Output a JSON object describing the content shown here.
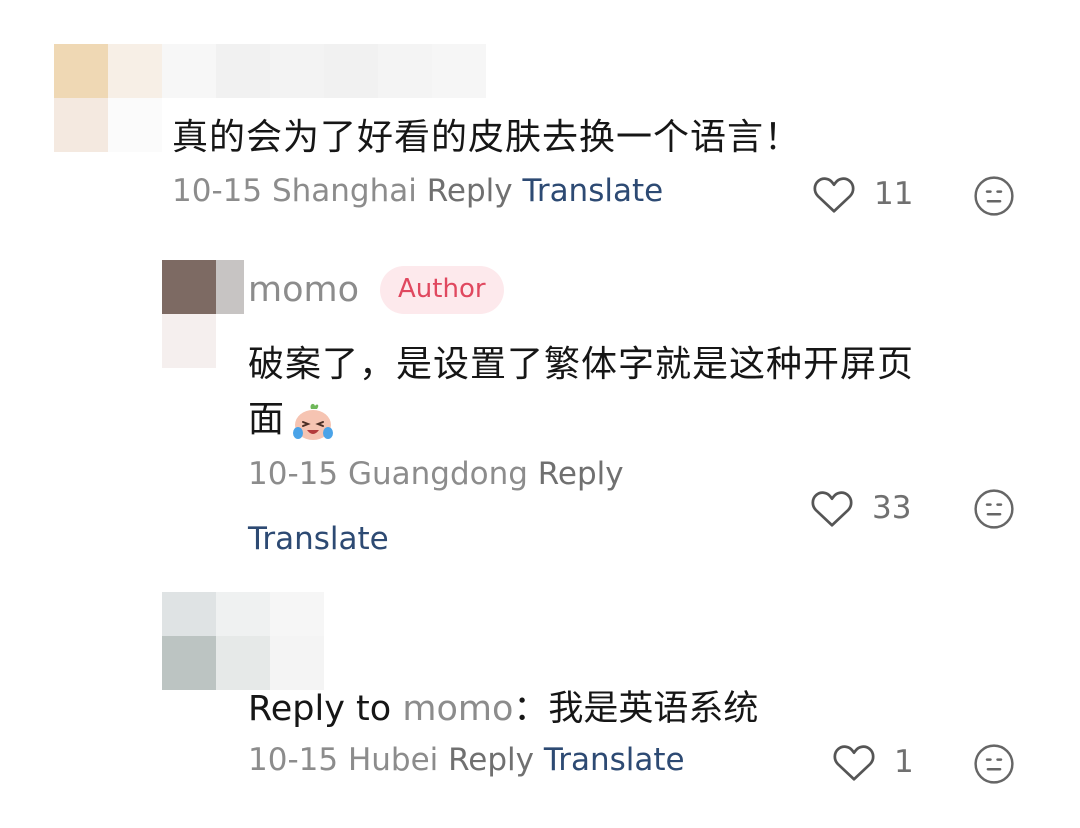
{
  "comments": [
    {
      "body": "真的会为了好看的皮肤去换一个语言！",
      "date": "10-15",
      "location": "Shanghai",
      "reply_label": "Reply",
      "translate_label": "Translate",
      "like_count": "11"
    },
    {
      "username": "momo",
      "badge": "Author",
      "body_line1": "破案了，是设置了繁体字就是这种开屏页",
      "body_line2": "面",
      "emoji_icon": "laughing-crying-emoji-icon",
      "date": "10-15",
      "location": "Guangdong",
      "reply_label": "Reply",
      "translate_label": "Translate",
      "like_count": "33"
    },
    {
      "reply_to_label": "Reply to",
      "reply_to_name": "momo",
      "body": "：我是英语系统",
      "date": "10-15",
      "location": "Hubei",
      "reply_label": "Reply",
      "translate_label": "Translate",
      "like_count": "1"
    }
  ],
  "colors": {
    "meta_gray": "#8c8c8c",
    "translate_blue": "#2d4a73",
    "badge_bg": "#fde9ec",
    "badge_text": "#e0485f"
  },
  "icons": [
    "heart-icon",
    "more-options-icon"
  ]
}
